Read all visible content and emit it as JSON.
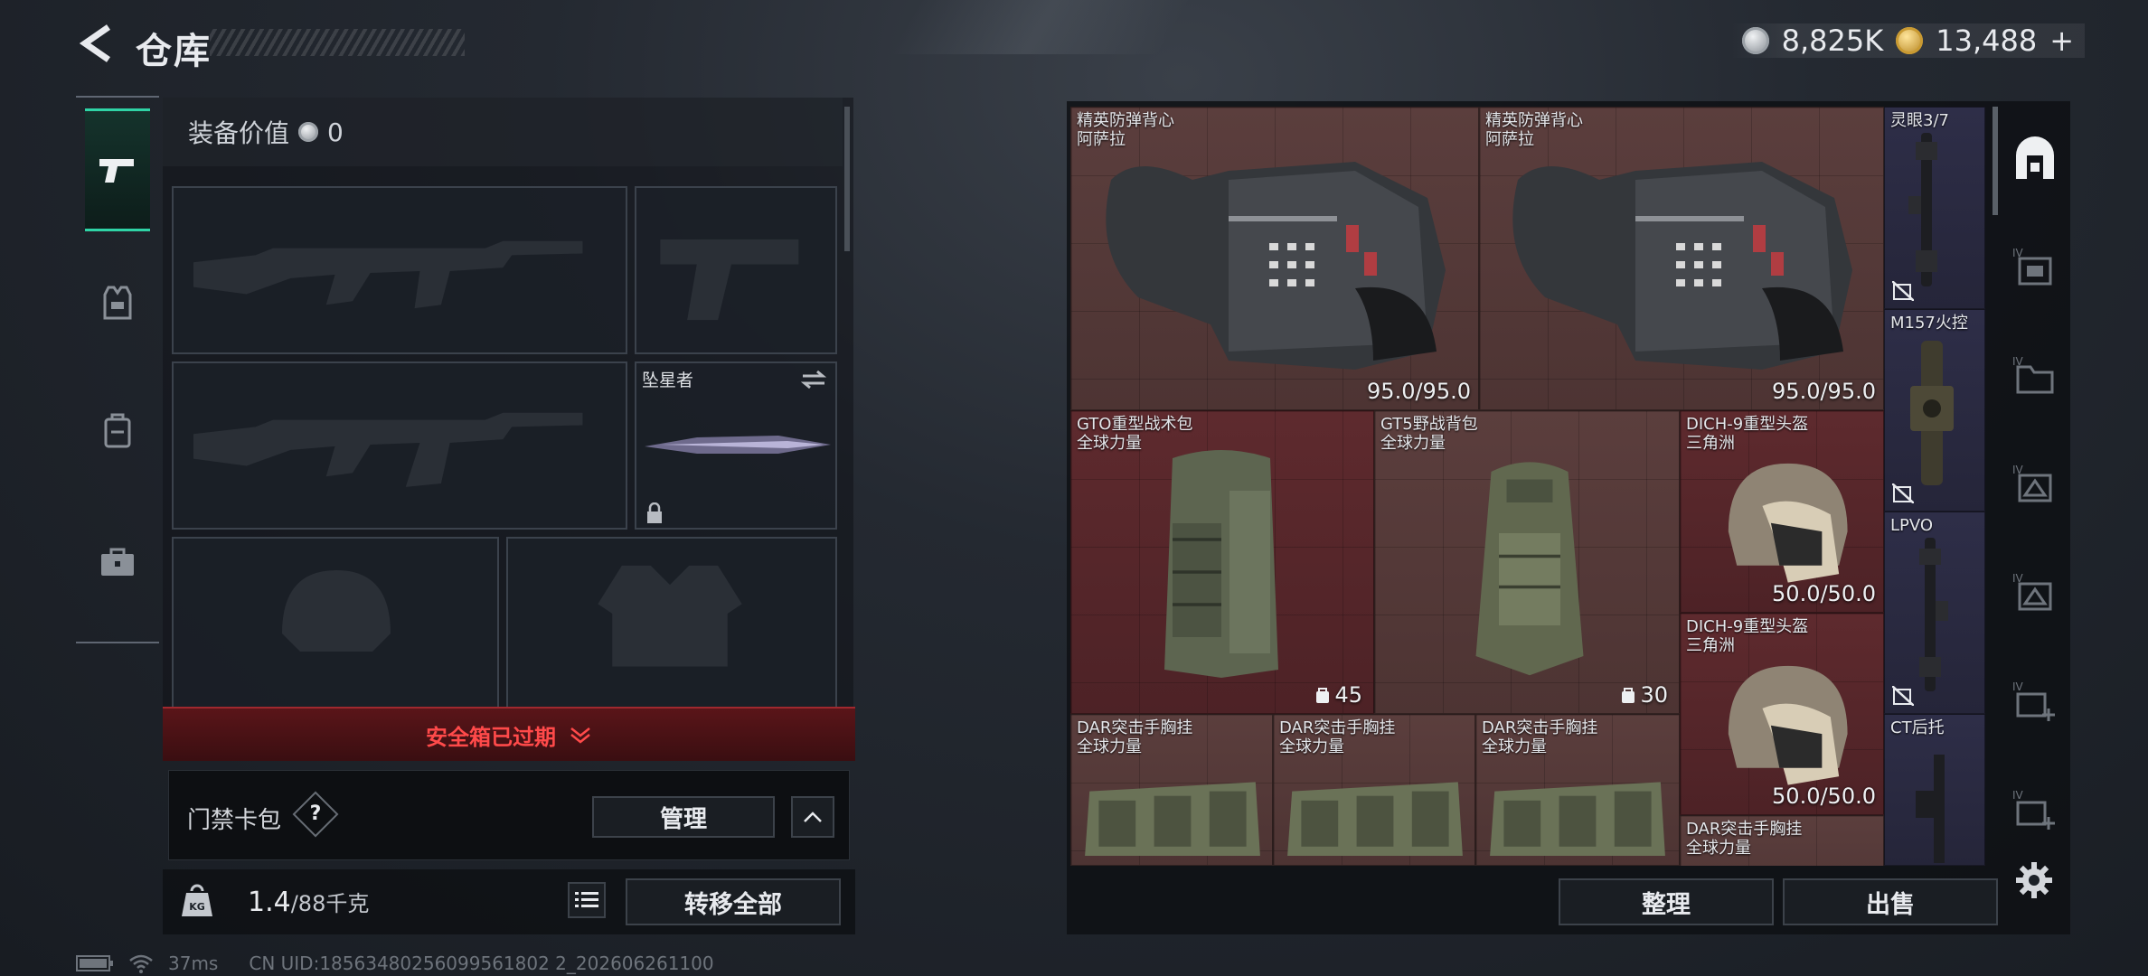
{
  "header": {
    "title": "仓库"
  },
  "currency": {
    "silver": "8,825K",
    "gold": "13,488",
    "gold_plus": "+"
  },
  "equipment": {
    "value_label": "装备价值",
    "value": "0",
    "melee_name": "坠星者",
    "safe_box_label": "安全箱已过期",
    "pass_label": "门禁卡包",
    "help": "?",
    "manage_label": "管理",
    "weight_current": "1.4",
    "weight_max": "/88千克",
    "transfer_all_label": "转移全部",
    "kg_icon_text": "KG"
  },
  "status": {
    "ping": "37ms",
    "uid": "CN UID:18563480256099561802 2_202606261100"
  },
  "inventory": {
    "items": [
      {
        "name": "精英防弹背心",
        "sub": "阿萨拉",
        "durability": "95.0/95.0",
        "rarity": "brown"
      },
      {
        "name": "精英防弹背心",
        "sub": "阿萨拉",
        "durability": "95.0/95.0",
        "rarity": "brown"
      },
      {
        "name": "灵眼3/7",
        "sub": "",
        "rarity": "purple"
      },
      {
        "name": "GTO重型战术包",
        "sub": "全球力量",
        "capacity": "45",
        "rarity": "red"
      },
      {
        "name": "GT5野战背包",
        "sub": "全球力量",
        "capacity": "30",
        "rarity": "brown"
      },
      {
        "name": "DICH-9重型头盔",
        "sub": "三角洲",
        "durability": "50.0/50.0",
        "rarity": "red"
      },
      {
        "name": "M157火控",
        "sub": "",
        "rarity": "purple"
      },
      {
        "name": "DICH-9重型头盔",
        "sub": "三角洲",
        "durability": "50.0/50.0",
        "rarity": "red"
      },
      {
        "name": "LPVO",
        "sub": "",
        "rarity": "purple"
      },
      {
        "name": "DAR突击手胸挂",
        "sub": "全球力量",
        "rarity": "brown"
      },
      {
        "name": "DAR突击手胸挂",
        "sub": "全球力量",
        "rarity": "brown"
      },
      {
        "name": "DAR突击手胸挂",
        "sub": "全球力量",
        "rarity": "brown"
      },
      {
        "name": "CT后托",
        "sub": "",
        "rarity": "purple"
      },
      {
        "name": "DAR突击手胸挂",
        "sub": "全球力量",
        "rarity": "brown"
      }
    ],
    "sort_label": "整理",
    "sell_label": "出售",
    "rail_level_text": "IV"
  }
}
